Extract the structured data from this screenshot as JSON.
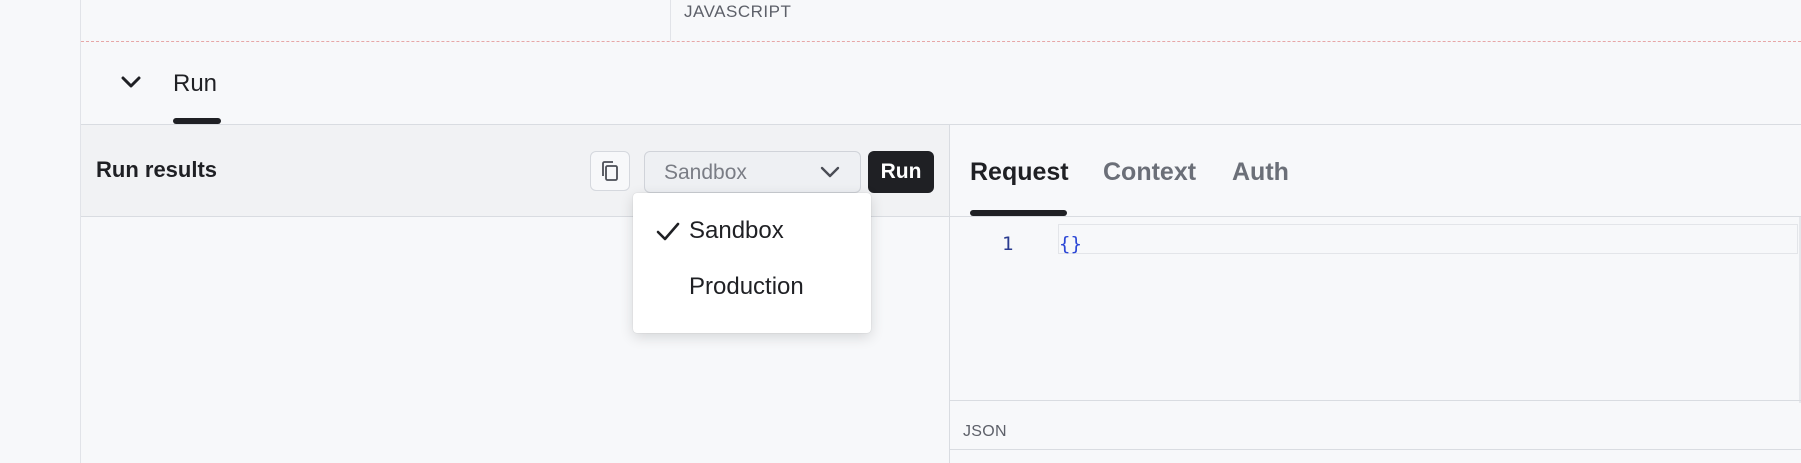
{
  "top": {
    "language_label": "JAVASCRIPT",
    "download_icon": "download-icon"
  },
  "run_section": {
    "tab_label": "Run",
    "collapse_icon": "chevron-down-icon",
    "expand_icon": "chevron-up-icon"
  },
  "results": {
    "title": "Run results",
    "copy_icon": "copy-icon",
    "environment_select": {
      "value": "Sandbox",
      "options": [
        {
          "label": "Sandbox",
          "selected": true
        },
        {
          "label": "Production",
          "selected": false
        }
      ]
    },
    "run_button": "Run"
  },
  "request_panel": {
    "tabs": [
      {
        "label": "Request",
        "active": true
      },
      {
        "label": "Context",
        "active": false
      },
      {
        "label": "Auth",
        "active": false
      }
    ],
    "editor": {
      "line_number": "1",
      "code": "{}"
    },
    "footer_label": "JSON"
  },
  "colors": {
    "accent_dark": "#1f2024",
    "code_blue": "#2c47d6",
    "line_number_blue": "#2a3b8f"
  }
}
